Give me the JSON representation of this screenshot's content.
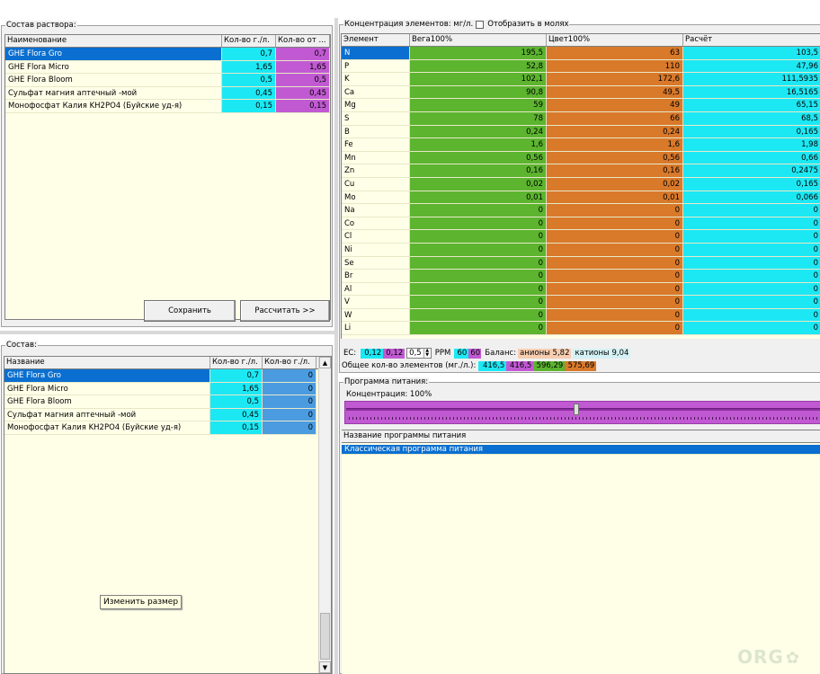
{
  "solution": {
    "title": "Состав раствора:",
    "columns": [
      "Наименование",
      "Кол-во г./л.",
      "Кол-во от ..."
    ],
    "rows": [
      {
        "name": "GHE Flora Gro",
        "qty": "0,7",
        "qty2": "0,7",
        "selected": true
      },
      {
        "name": "GHE Flora Micro",
        "qty": "1,65",
        "qty2": "1,65",
        "selected": false
      },
      {
        "name": "GHE Flora Bloom",
        "qty": "0,5",
        "qty2": "0,5",
        "selected": false
      },
      {
        "name": "Сульфат магния аптечный -мой",
        "qty": "0,45",
        "qty2": "0,45",
        "selected": false
      },
      {
        "name": "Монофосфат Калия KH2PO4 (Буйские уд-я)",
        "qty": "0,15",
        "qty2": "0,15",
        "selected": false
      }
    ],
    "save_label": "Сохранить",
    "calc_label": "Рассчитать >>"
  },
  "composition": {
    "title": "Состав:",
    "columns": [
      "Название",
      "Кол-во г./л.",
      "Кол-во г./л."
    ],
    "rows": [
      {
        "name": "GHE Flora Gro",
        "qty": "0,7",
        "qty2": "0",
        "selected": true
      },
      {
        "name": "GHE Flora Micro",
        "qty": "1,65",
        "qty2": "0",
        "selected": false
      },
      {
        "name": "GHE Flora Bloom",
        "qty": "0,5",
        "qty2": "0",
        "selected": false
      },
      {
        "name": "Сульфат магния аптечный -мой",
        "qty": "0,45",
        "qty2": "0",
        "selected": false
      },
      {
        "name": "Монофосфат Калия KH2PO4 (Буйские уд-я)",
        "qty": "0,15",
        "qty2": "0",
        "selected": false
      }
    ],
    "resize_label": "Изменить размер"
  },
  "concentration": {
    "title": "Концентрация элементов: мг/л.",
    "moles_label": "Отобразить в молях",
    "columns": [
      "Элемент",
      "Вега100%",
      "Цвет100%",
      "Расчёт"
    ],
    "rows": [
      {
        "el": "N",
        "veg": "195,5",
        "bloom": "63",
        "calc": "103,5",
        "selected": true
      },
      {
        "el": "P",
        "veg": "52,8",
        "bloom": "110",
        "calc": "47,96"
      },
      {
        "el": "K",
        "veg": "102,1",
        "bloom": "172,6",
        "calc": "111,5935"
      },
      {
        "el": "Ca",
        "veg": "90,8",
        "bloom": "49,5",
        "calc": "16,5165"
      },
      {
        "el": "Mg",
        "veg": "59",
        "bloom": "49",
        "calc": "65,15"
      },
      {
        "el": "S",
        "veg": "78",
        "bloom": "66",
        "calc": "68,5"
      },
      {
        "el": "B",
        "veg": "0,24",
        "bloom": "0,24",
        "calc": "0,165"
      },
      {
        "el": "Fe",
        "veg": "1,6",
        "bloom": "1,6",
        "calc": "1,98"
      },
      {
        "el": "Mn",
        "veg": "0,56",
        "bloom": "0,56",
        "calc": "0,66"
      },
      {
        "el": "Zn",
        "veg": "0,16",
        "bloom": "0,16",
        "calc": "0,2475"
      },
      {
        "el": "Cu",
        "veg": "0,02",
        "bloom": "0,02",
        "calc": "0,165"
      },
      {
        "el": "Mo",
        "veg": "0,01",
        "bloom": "0,01",
        "calc": "0,066"
      },
      {
        "el": "Na",
        "veg": "0",
        "bloom": "0",
        "calc": "0"
      },
      {
        "el": "Co",
        "veg": "0",
        "bloom": "0",
        "calc": "0"
      },
      {
        "el": "Cl",
        "veg": "0",
        "bloom": "0",
        "calc": "0"
      },
      {
        "el": "Ni",
        "veg": "0",
        "bloom": "0",
        "calc": "0"
      },
      {
        "el": "Se",
        "veg": "0",
        "bloom": "0",
        "calc": "0"
      },
      {
        "el": "Br",
        "veg": "0",
        "bloom": "0",
        "calc": "0"
      },
      {
        "el": "Al",
        "veg": "0",
        "bloom": "0",
        "calc": "0"
      },
      {
        "el": "V",
        "veg": "0",
        "bloom": "0",
        "calc": "0"
      },
      {
        "el": "W",
        "veg": "0",
        "bloom": "0",
        "calc": "0"
      },
      {
        "el": "Li",
        "veg": "0",
        "bloom": "0",
        "calc": "0"
      }
    ]
  },
  "stats": {
    "ec_label": "EC:",
    "ec_a": "0,12",
    "ec_b": "0,12",
    "ec_input": "0,5",
    "ppm_label": "PPM",
    "ppm_a": "60",
    "ppm_b": "60",
    "balance_label": "Баланс:",
    "anions_label": "анионы",
    "anions_value": "5,82",
    "cations_label": "катионы",
    "cations_value": "9,04",
    "total_label": "Общее кол-во элементов (мг./л.):",
    "total_a": "416,5",
    "total_b": "416,5",
    "total_c": "596,29",
    "total_d": "575,69"
  },
  "program": {
    "title": "Программа питания:",
    "concentration_label": "Концентрация: 100%",
    "concentration_percent": 100,
    "list_header": "Название программы питания",
    "items": [
      {
        "name": "Классическая программа питания",
        "selected": true
      }
    ]
  },
  "watermark": "ORG",
  "colors": {
    "cyan": "#1ce8f4",
    "magenta": "#c15ad2",
    "green": "#5cb42f",
    "orange": "#d9792a",
    "selection": "#0a6fd0",
    "cream": "#ffffe8"
  }
}
